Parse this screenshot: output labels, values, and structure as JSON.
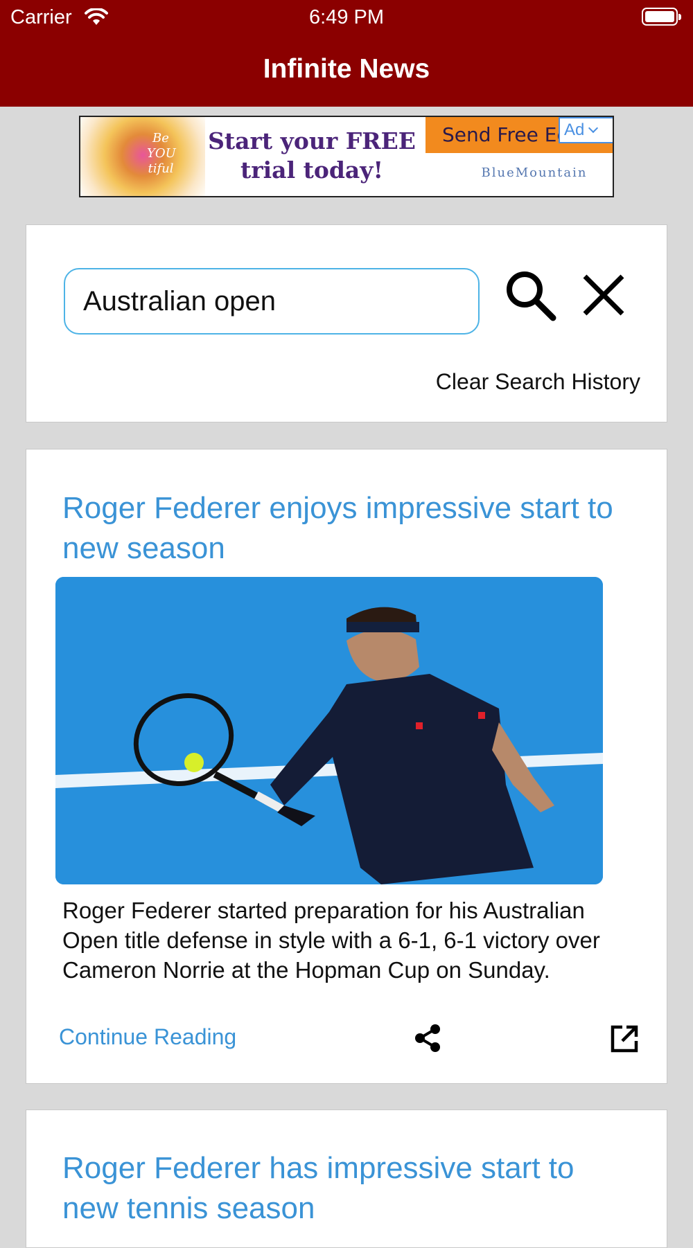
{
  "status_bar": {
    "carrier": "Carrier",
    "time": "6:49 PM"
  },
  "nav": {
    "title": "Infinite News"
  },
  "ad": {
    "flower_text": "Be YOU tiful",
    "headline": "Start your FREE trial today!",
    "cta": "Send Free Ecards",
    "brand": "BlueMountain",
    "chip_label": "Ad"
  },
  "search": {
    "value": "Australian open",
    "clear_history_label": "Clear Search History"
  },
  "articles": [
    {
      "title": "Roger Federer enjoys impressive start to new season",
      "summary": "Roger Federer started preparation for his Australian Open title defense in style with a 6-1, 6-1 victory over Cameron Norrie at the Hopman Cup on Sunday.",
      "continue_label": "Continue Reading"
    },
    {
      "title": "Roger Federer has impressive start to new tennis season"
    }
  ],
  "colors": {
    "header": "#8b0000",
    "link": "#3a93d6",
    "input_border": "#4db3e6",
    "background": "#d9d9d9"
  }
}
